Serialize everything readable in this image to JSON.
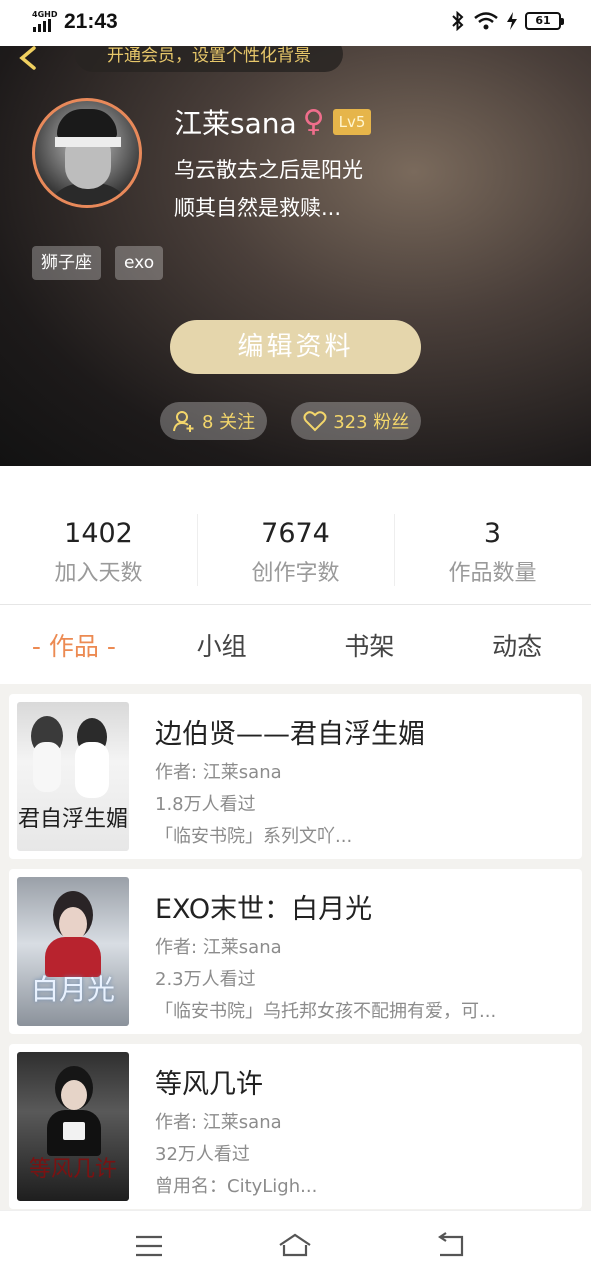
{
  "status_bar": {
    "network": "4GHD",
    "time": "21:43",
    "battery": "61"
  },
  "header": {
    "vip_banner": "开通会员，设置个性化背景",
    "username": "江莱sana",
    "gender": "♀",
    "level": "Lv5",
    "bio_lines": [
      "乌云散去之后是阳光",
      "顺其自然是救赎..."
    ],
    "tags": [
      "狮子座",
      "exo"
    ],
    "edit_button": "编辑资料",
    "following": "8 关注",
    "followers": "323 粉丝"
  },
  "stats": [
    {
      "value": "1402",
      "label": "加入天数"
    },
    {
      "value": "7674",
      "label": "创作字数"
    },
    {
      "value": "3",
      "label": "作品数量"
    }
  ],
  "tabs": [
    {
      "label": "作品",
      "active": true
    },
    {
      "label": "小组",
      "active": false
    },
    {
      "label": "书架",
      "active": false
    },
    {
      "label": "动态",
      "active": false
    }
  ],
  "works": [
    {
      "title": "边伯贤——君自浮生媚",
      "author": "作者: 江莱sana",
      "views": "1.8万人看过",
      "desc": "「临安书院」系列文吖...",
      "cover_text": "君自浮生媚"
    },
    {
      "title": "EXO末世：白月光",
      "author": "作者: 江莱sana",
      "views": "2.3万人看过",
      "desc": "「临安书院」乌托邦女孩不配拥有爱，可...",
      "cover_text": "白月光"
    },
    {
      "title": "等风几许",
      "author": "作者: 江莱sana",
      "views": "32万人看过",
      "desc": "曾用名：CityLigh...",
      "cover_text": "等风几许"
    }
  ]
}
